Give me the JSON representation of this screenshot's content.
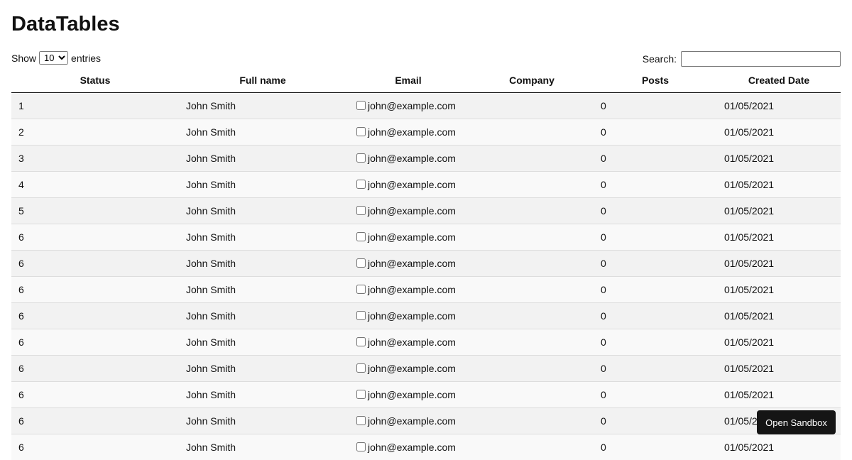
{
  "title": "DataTables",
  "length": {
    "show_label": "Show",
    "value": "10",
    "entries_label": "entries"
  },
  "search": {
    "label": "Search:",
    "value": ""
  },
  "columns": [
    "Status",
    "Full name",
    "Email",
    "Company",
    "Posts",
    "Created Date"
  ],
  "rows": [
    {
      "status": "1",
      "name": "John Smith",
      "email": "john@example.com",
      "company": "",
      "posts": "0",
      "date": "01/05/2021"
    },
    {
      "status": "2",
      "name": "John Smith",
      "email": "john@example.com",
      "company": "",
      "posts": "0",
      "date": "01/05/2021"
    },
    {
      "status": "3",
      "name": "John Smith",
      "email": "john@example.com",
      "company": "",
      "posts": "0",
      "date": "01/05/2021"
    },
    {
      "status": "4",
      "name": "John Smith",
      "email": "john@example.com",
      "company": "",
      "posts": "0",
      "date": "01/05/2021"
    },
    {
      "status": "5",
      "name": "John Smith",
      "email": "john@example.com",
      "company": "",
      "posts": "0",
      "date": "01/05/2021"
    },
    {
      "status": "6",
      "name": "John Smith",
      "email": "john@example.com",
      "company": "",
      "posts": "0",
      "date": "01/05/2021"
    },
    {
      "status": "6",
      "name": "John Smith",
      "email": "john@example.com",
      "company": "",
      "posts": "0",
      "date": "01/05/2021"
    },
    {
      "status": "6",
      "name": "John Smith",
      "email": "john@example.com",
      "company": "",
      "posts": "0",
      "date": "01/05/2021"
    },
    {
      "status": "6",
      "name": "John Smith",
      "email": "john@example.com",
      "company": "",
      "posts": "0",
      "date": "01/05/2021"
    },
    {
      "status": "6",
      "name": "John Smith",
      "email": "john@example.com",
      "company": "",
      "posts": "0",
      "date": "01/05/2021"
    },
    {
      "status": "6",
      "name": "John Smith",
      "email": "john@example.com",
      "company": "",
      "posts": "0",
      "date": "01/05/2021"
    },
    {
      "status": "6",
      "name": "John Smith",
      "email": "john@example.com",
      "company": "",
      "posts": "0",
      "date": "01/05/2021"
    },
    {
      "status": "6",
      "name": "John Smith",
      "email": "john@example.com",
      "company": "",
      "posts": "0",
      "date": "01/05/2021"
    },
    {
      "status": "6",
      "name": "John Smith",
      "email": "john@example.com",
      "company": "",
      "posts": "0",
      "date": "01/05/2021"
    }
  ],
  "sandbox_button": "Open Sandbox"
}
